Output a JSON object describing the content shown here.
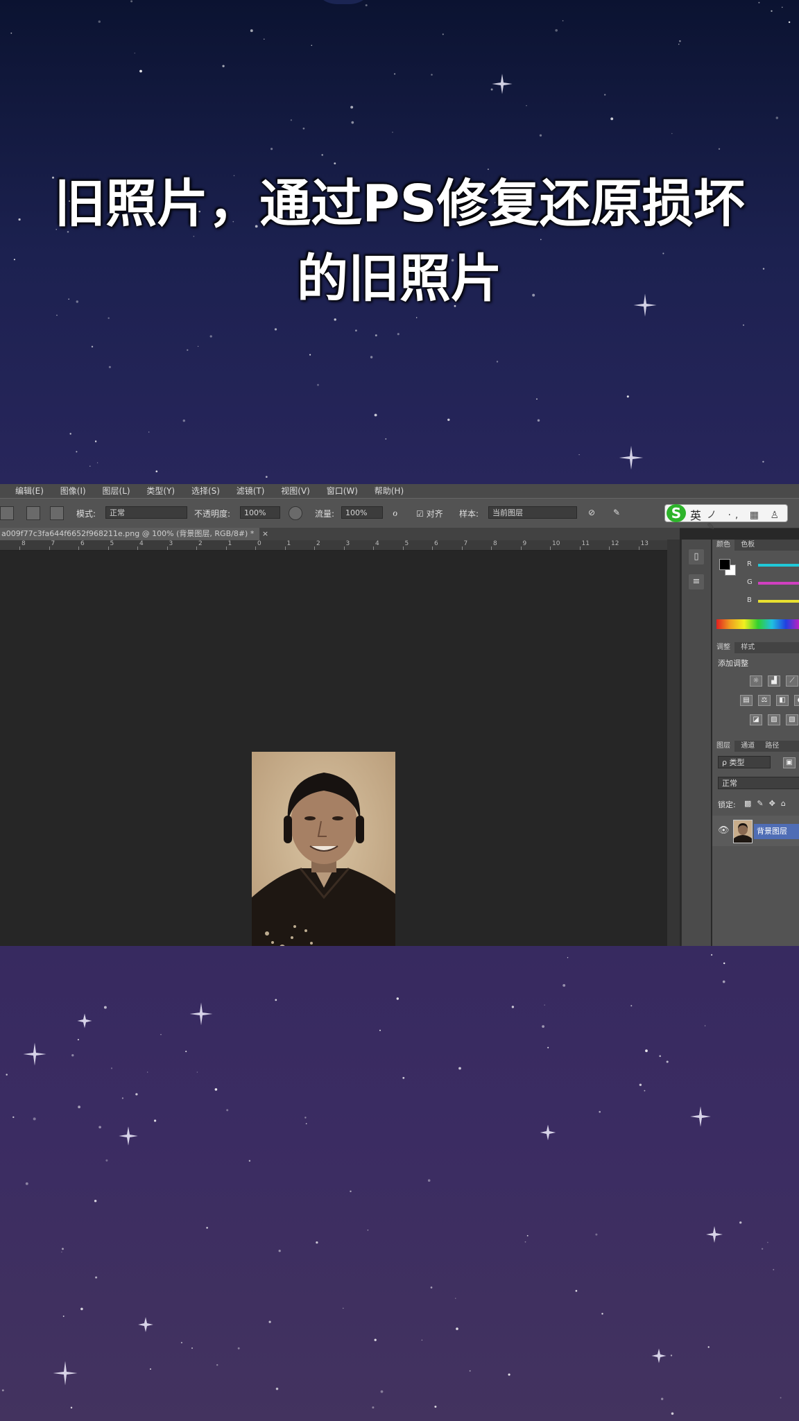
{
  "headline": {
    "line1": "旧照片，通过PS修复还原损坏",
    "line2": "的旧照片"
  },
  "photoshop": {
    "menu": [
      "编辑(E)",
      "图像(I)",
      "图层(L)",
      "类型(Y)",
      "选择(S)",
      "滤镜(T)",
      "视图(V)",
      "窗口(W)",
      "帮助(H)"
    ],
    "options": {
      "mode_label": "模式:",
      "mode_value": "正常",
      "opacity_label": "不透明度:",
      "opacity_value": "100%",
      "flow_label": "流量:",
      "flow_value": "100%",
      "align_label": "对齐",
      "sample_label": "样本:",
      "sample_value": "当前图层"
    },
    "ime": {
      "logo": "S",
      "lang": "英",
      "extras": "ノ ·, ▦ ♙ ✎"
    },
    "document_tab": "a009f77c3fa644f6652f968211e.png @ 100% (背景图层, RGB/8#) *",
    "ruler_ticks": [
      "8",
      "7",
      "6",
      "5",
      "4",
      "3",
      "2",
      "1",
      "0",
      "1",
      "2",
      "3",
      "4",
      "5",
      "6",
      "7",
      "8",
      "9",
      "10",
      "11",
      "12",
      "13"
    ],
    "panels": {
      "color_tabs": [
        "颜色",
        "色板"
      ],
      "channels": [
        "R",
        "G",
        "B"
      ],
      "channel_colors": [
        "#20c8d8",
        "#d040c0",
        "#e8e030"
      ],
      "adjust_tabs": [
        "调整",
        "样式"
      ],
      "adjust_title": "添加调整",
      "layers_tabs": [
        "图层",
        "通道",
        "路径"
      ],
      "layers_filter": "ρ 类型",
      "blend_mode": "正常",
      "lock_label": "锁定:",
      "layer_name": "背景图层"
    }
  }
}
